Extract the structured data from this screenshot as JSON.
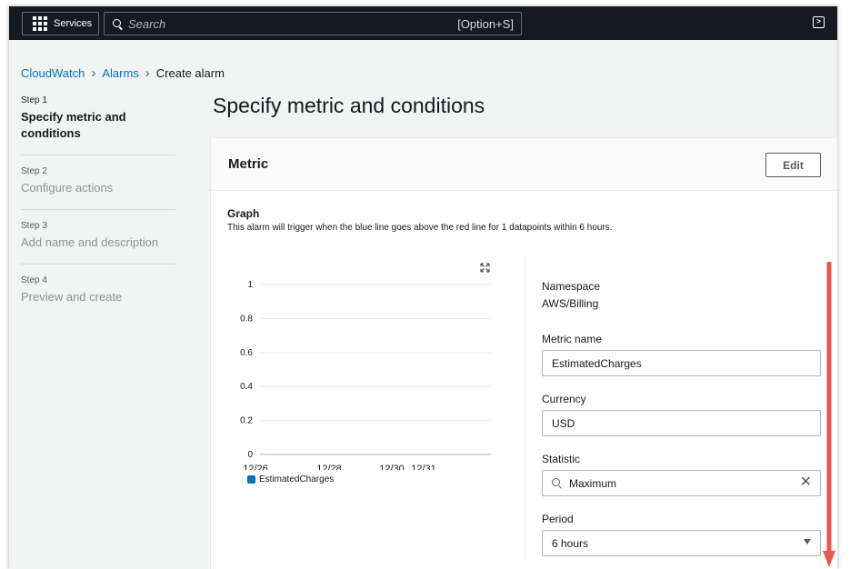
{
  "nav": {
    "services_label": "Services",
    "search_placeholder": "Search",
    "search_shortcut": "[Option+S]"
  },
  "breadcrumb": {
    "items": [
      "CloudWatch",
      "Alarms"
    ],
    "current": "Create alarm"
  },
  "steps": [
    {
      "number": "Step 1",
      "title": "Specify metric and conditions"
    },
    {
      "number": "Step 2",
      "title": "Configure actions"
    },
    {
      "number": "Step 3",
      "title": "Add name and description"
    },
    {
      "number": "Step 4",
      "title": "Preview and create"
    }
  ],
  "page_title": "Specify metric and conditions",
  "metric_panel": {
    "title": "Metric",
    "edit_label": "Edit",
    "graph_title": "Graph",
    "graph_description": "This alarm will trigger when the blue line goes above the red line for 1 datapoints within 6 hours."
  },
  "chart_data": {
    "type": "line",
    "y_ticks": [
      "1",
      "0.8",
      "0.6",
      "0.4",
      "0.2",
      "0"
    ],
    "x_ticks": [
      "12/26",
      "12/28",
      "12/30",
      "12/31"
    ],
    "ylim": [
      0,
      1
    ],
    "series": [
      {
        "name": "EstimatedCharges",
        "values": []
      }
    ],
    "series_color": "#0073bb",
    "grid": true
  },
  "details": {
    "namespace_label": "Namespace",
    "namespace_value": "AWS/Billing",
    "metric_name_label": "Metric name",
    "metric_name_value": "EstimatedCharges",
    "currency_label": "Currency",
    "currency_value": "USD",
    "statistic_label": "Statistic",
    "statistic_value": "Maximum",
    "period_label": "Period",
    "period_value": "6 hours"
  },
  "colors": {
    "nav_bg": "#16191f",
    "link": "#0073bb",
    "annotation_arrow": "#e8564b"
  }
}
